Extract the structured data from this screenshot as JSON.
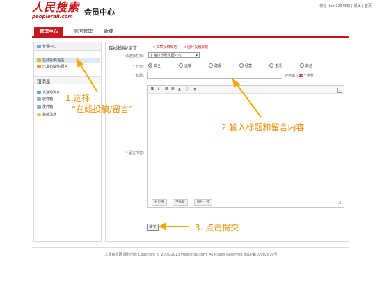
{
  "header": {
    "logo_text": "人民搜索",
    "logo_sub": "peoplerail.com",
    "site_title": "会员中心",
    "greeting": "你好 (test123456)",
    "logout": "退出",
    "home": "首页"
  },
  "nav": {
    "tabs": [
      {
        "label": "管理中心"
      },
      {
        "label": "账号管理"
      },
      {
        "label": "收藏"
      }
    ]
  },
  "sidebar": {
    "header": "管理中心",
    "items": [
      {
        "label": "在线投稿/留言"
      },
      {
        "label": "已发布稿件/留言"
      }
    ],
    "section2": "短消息",
    "msg_items": [
      {
        "label": "发送短消息"
      },
      {
        "label": "收件箱"
      },
      {
        "label": "发件箱"
      },
      {
        "label": "系统消息"
      }
    ]
  },
  "form": {
    "title": "在线投稿/留言",
    "link1": ">文章投稿规范",
    "link2": ">图片投稿规范",
    "column_label": "请选择栏目：",
    "column_value": "├ 哈尔滨局集团公司",
    "category_label": "分类：",
    "categories": [
      "安全",
      "运输",
      "建设",
      "经营",
      "生活",
      "其他"
    ],
    "title_label": "标题：",
    "hint_pre": "还可输入",
    "hint_num": "80",
    "hint_post": "个字符",
    "content_label": "留言内容：",
    "toolbar": [
      "B",
      "I",
      "☰",
      "☰",
      "▲",
      "☺",
      "◉"
    ],
    "editor_buttons": [
      "分页符",
      "子标题",
      "附件上传"
    ],
    "submit": "提交"
  },
  "annotations": {
    "step1_line1": "1.选择",
    "step1_line2": "“在线投稿/留言”",
    "step2": "2.输入标题和留言内容",
    "step3": "3. 点击提交"
  },
  "footer": {
    "text": "人民铁道网 版权所有 Copyright © 2006-2013 Peoplerail.com, All Rights Reserved 京ICP备10002870号"
  },
  "colors": {
    "brand_red": "#c8161d",
    "annotation_orange": "#f08a00"
  }
}
